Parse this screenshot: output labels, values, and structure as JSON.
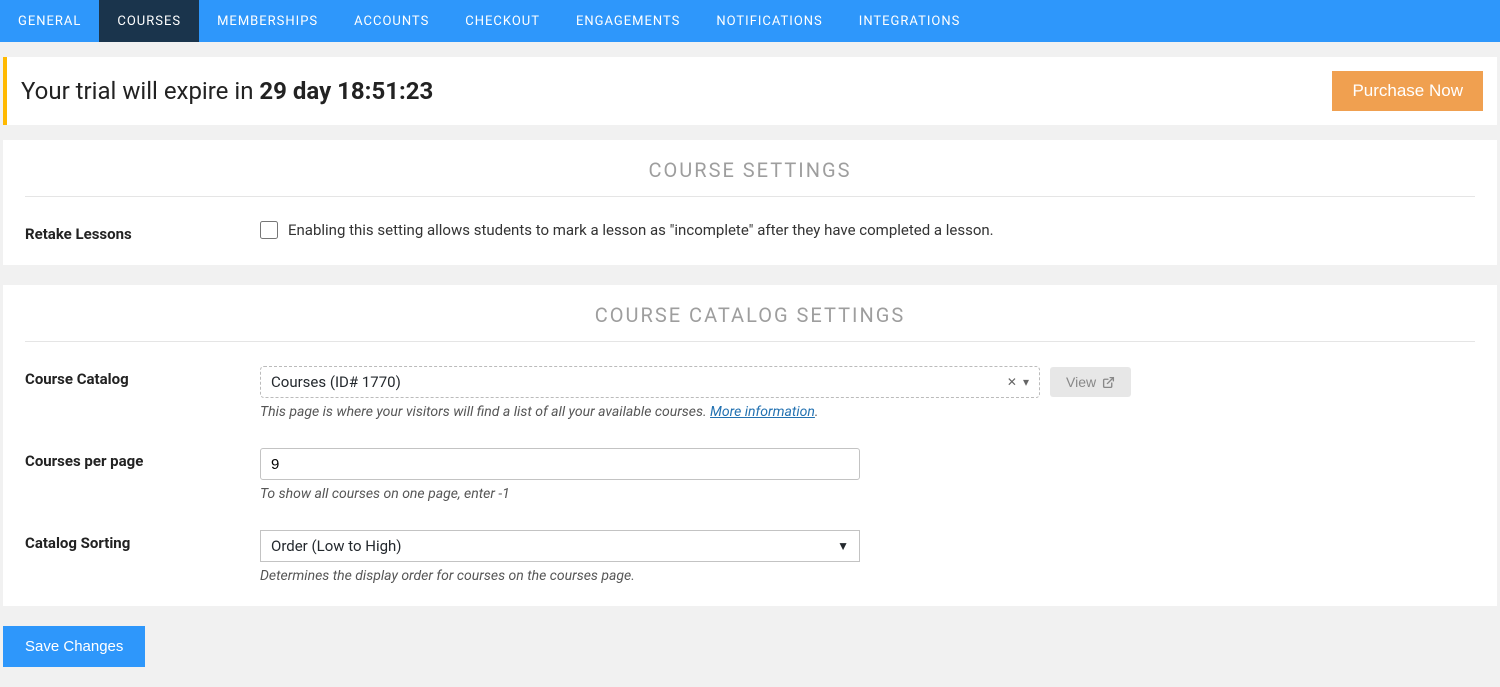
{
  "tabs": [
    "GENERAL",
    "COURSES",
    "MEMBERSHIPS",
    "ACCOUNTS",
    "CHECKOUT",
    "ENGAGEMENTS",
    "NOTIFICATIONS",
    "INTEGRATIONS"
  ],
  "activeTab": "COURSES",
  "trial": {
    "prefix": "Your trial will expire in ",
    "countdown": "29 day 18:51:23",
    "purchaseLabel": "Purchase Now"
  },
  "courseSettings": {
    "title": "COURSE SETTINGS",
    "retakeLessons": {
      "label": "Retake Lessons",
      "description": "Enabling this setting allows students to mark a lesson as \"incomplete\" after they have completed a lesson.",
      "checked": false
    }
  },
  "catalogSettings": {
    "title": "COURSE CATALOG SETTINGS",
    "courseCatalog": {
      "label": "Course Catalog",
      "selected": "Courses (ID# 1770)",
      "viewLabel": "View",
      "help": "This page is where your visitors will find a list of all your available courses. ",
      "helpLink": "More information"
    },
    "coursesPerPage": {
      "label": "Courses per page",
      "value": "9",
      "help": "To show all courses on one page, enter -1"
    },
    "catalogSorting": {
      "label": "Catalog Sorting",
      "selected": "Order (Low to High)",
      "help": "Determines the display order for courses on the courses page."
    }
  },
  "saveLabel": "Save Changes"
}
